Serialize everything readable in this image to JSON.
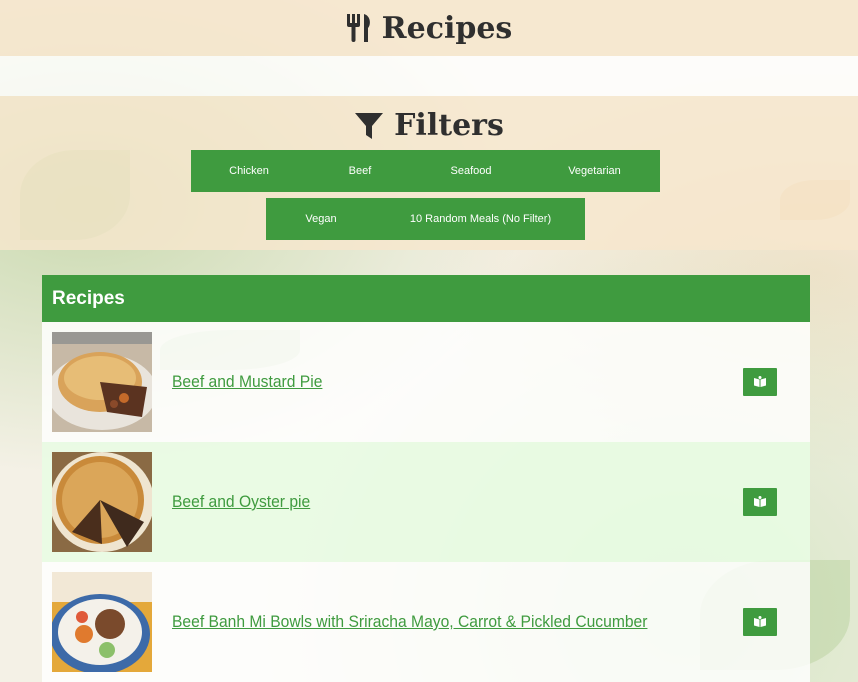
{
  "header": {
    "title": "Recipes",
    "icon": "utensils-icon"
  },
  "filters": {
    "title": "Filters",
    "icon": "filter-icon",
    "buttons_row1": [
      "Chicken",
      "Beef",
      "Seafood",
      "Vegetarian"
    ],
    "buttons_row2": [
      "Vegan",
      "10 Random Meals (No Filter)"
    ]
  },
  "recipes": {
    "panel_title": "Recipes",
    "items": [
      {
        "name": "Beef and Mustard Pie",
        "thumb": "pie-with-gravy-photo",
        "action_icon": "book-open-icon"
      },
      {
        "name": "Beef and Oyster pie",
        "thumb": "sliced-pie-photo",
        "action_icon": "book-open-icon"
      },
      {
        "name": "Beef Banh Mi Bowls with Sriracha Mayo, Carrot & Pickled Cucumber",
        "thumb": "banh-mi-bowl-photo",
        "action_icon": "book-open-icon"
      }
    ]
  },
  "colors": {
    "accent": "#3f9b3f",
    "header_bg": "#f6e6cd",
    "alt_row": "#e8fce4"
  }
}
